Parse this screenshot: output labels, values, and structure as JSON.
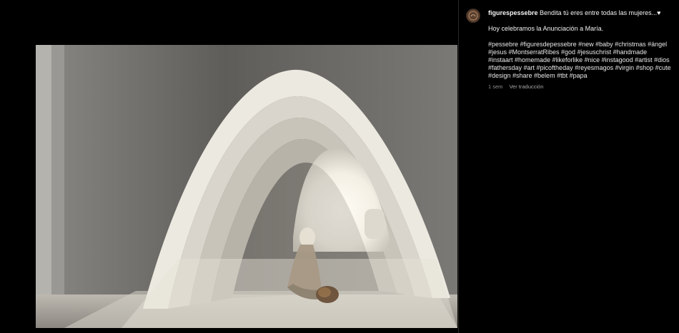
{
  "post": {
    "username": "figurespessebre",
    "title_text": "Bendita tú eres entre todas las mujeres...",
    "heart_glyph": "♥",
    "body_line": "Hoy celebramos la Anunciación a María.",
    "hashtags": "#pessebre #figuresdepessebre #new #baby #christmas #ángel #jesus #MontserratRibes #god #jesuschrist #handmade #instaart #homemade #likeforlike #nice #instagood #artist #dios #fathersday #art #picoftheday #reyesmagos #virgin #shop #cute #design #share #belem #tbt #papa",
    "time_ago": "1 sem",
    "translate_label": "Ver traducción"
  },
  "colors": {
    "background": "#000000",
    "caption_text": "#f2f2f2",
    "meta_text": "#8e8e8e"
  },
  "icons": {
    "avatar": "profile-logo-icon",
    "heart": "heart-icon"
  }
}
